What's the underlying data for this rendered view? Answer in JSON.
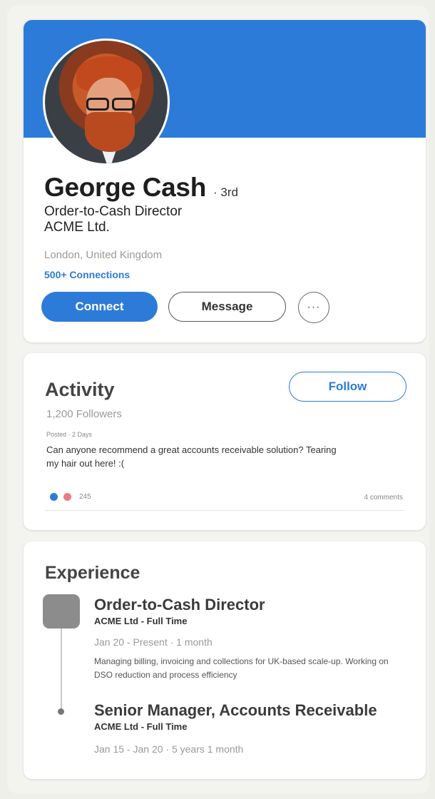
{
  "profile": {
    "name": "George Cash",
    "degree": "· 3rd",
    "title": "Order-to-Cash Director",
    "company": "ACME Ltd.",
    "location": "London, United Kingdom",
    "connections": "500+ Connections",
    "banner_color": "#2d7bd8",
    "buttons": {
      "connect": "Connect",
      "message": "Message",
      "more": "···"
    }
  },
  "activity": {
    "heading": "Activity",
    "follow_label": "Follow",
    "followers": "1,200 Followers",
    "post": {
      "posted": "Posted · 2 Days",
      "text": "Can anyone recommend a great accounts receivable solution? Tearing my hair out here! :(",
      "reaction_count": "245",
      "comments": "4 comments"
    }
  },
  "experience": {
    "heading": "Experience",
    "jobs": [
      {
        "title": "Order-to-Cash Director",
        "company": "ACME Ltd - Full Time",
        "dates": "Jan 20 - Present · 1 month",
        "description": "Managing billing, invoicing and collections for UK-based scale-up. Working on DSO reduction and process efficiency"
      },
      {
        "title": "Senior Manager, Accounts Receivable",
        "company": "ACME Ltd - Full Time",
        "dates": "Jan 15 - Jan 20 · 5 years 1 month"
      }
    ]
  }
}
